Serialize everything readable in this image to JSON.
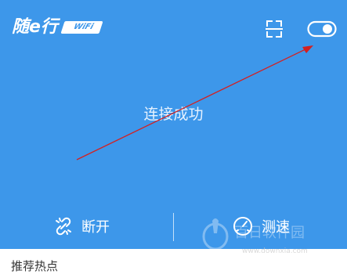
{
  "header": {
    "logo_text": "随e行",
    "logo_badge": "WiFi",
    "scan_icon": "scan-icon",
    "toggle_icon": "toggle-icon"
  },
  "main": {
    "status": "连接成功"
  },
  "actions": {
    "disconnect_label": "断开",
    "disconnect_icon": "broken-link-icon",
    "speedtest_label": "测速",
    "speedtest_icon": "speedometer-icon"
  },
  "section": {
    "title": "推荐热点"
  },
  "watermark": {
    "text": "百日软件园",
    "url": "www.downxia.com"
  },
  "colors": {
    "primary": "#3d97ea",
    "arrow": "#d42020"
  }
}
